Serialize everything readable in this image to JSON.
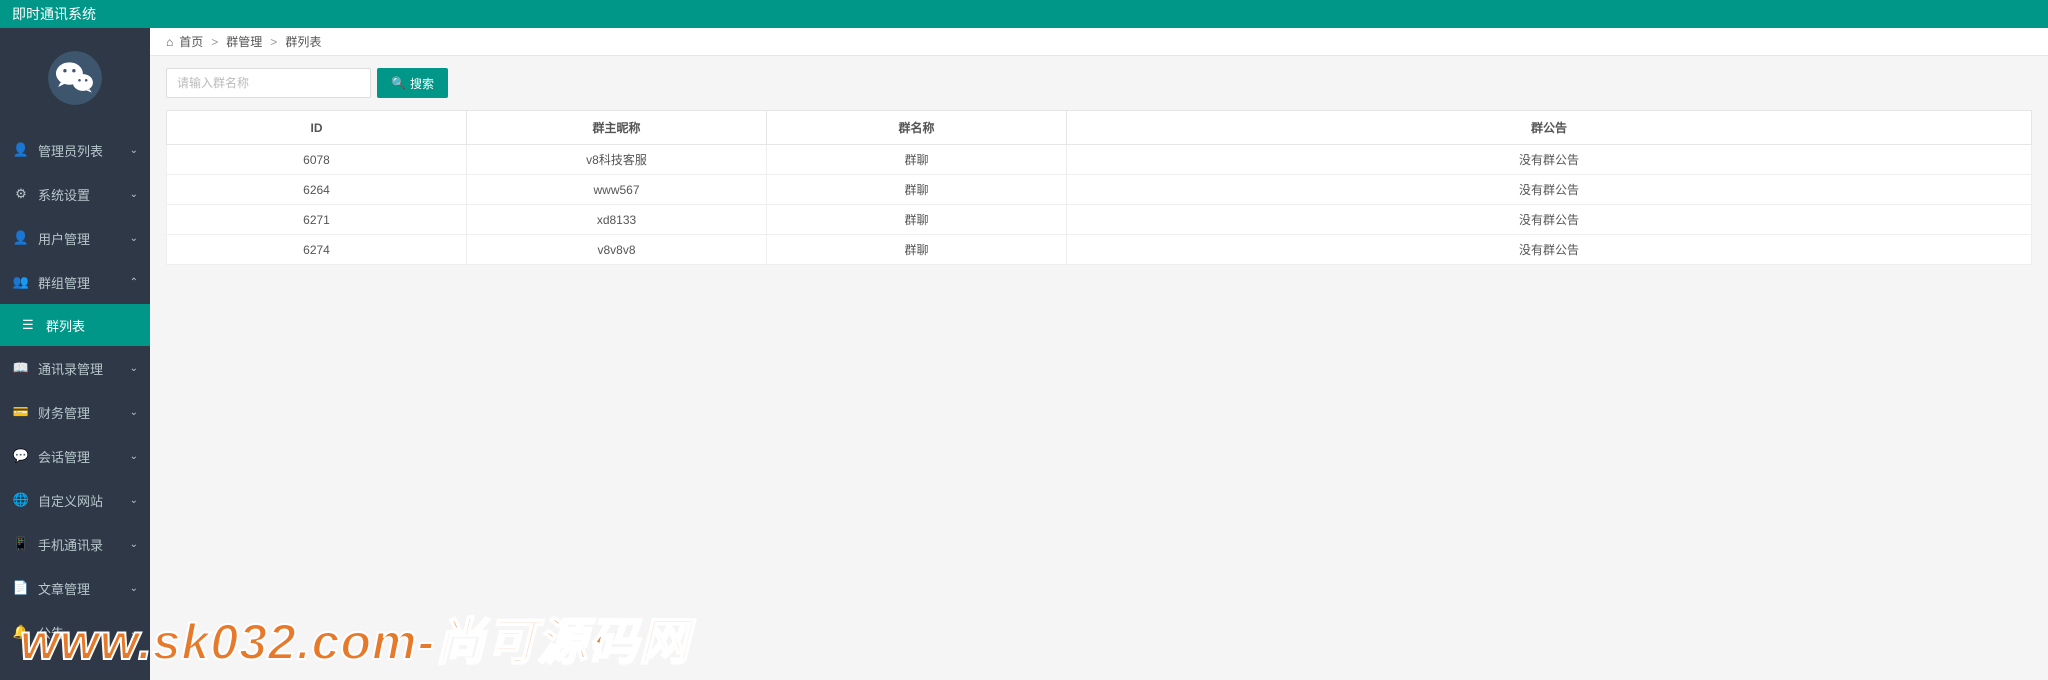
{
  "app": {
    "title": "即时通讯系统"
  },
  "sidebar": {
    "items": [
      {
        "label": "管理员列表",
        "icon": "person"
      },
      {
        "label": "系统设置",
        "icon": "gear"
      },
      {
        "label": "用户管理",
        "icon": "person"
      },
      {
        "label": "群组管理",
        "icon": "people",
        "expanded": true,
        "children": [
          {
            "label": "群列表",
            "icon": "list"
          }
        ]
      },
      {
        "label": "通讯录管理",
        "icon": "book"
      },
      {
        "label": "财务管理",
        "icon": "card"
      },
      {
        "label": "会话管理",
        "icon": "chat"
      },
      {
        "label": "自定义网站",
        "icon": "globe"
      },
      {
        "label": "手机通讯录",
        "icon": "phone"
      },
      {
        "label": "文章管理",
        "icon": "doc"
      },
      {
        "label": "公告",
        "icon": "bell"
      }
    ]
  },
  "breadcrumb": {
    "home": "首页",
    "sep": ">",
    "l2": "群管理",
    "l3": "群列表"
  },
  "search": {
    "placeholder": "请输入群名称",
    "button": "搜索"
  },
  "table": {
    "headers": {
      "id": "ID",
      "owner": "群主昵称",
      "name": "群名称",
      "notice": "群公告"
    },
    "rows": [
      {
        "id": "6078",
        "owner": "v8科技客服",
        "name": "群聊",
        "notice": "没有群公告"
      },
      {
        "id": "6264",
        "owner": "www567",
        "name": "群聊",
        "notice": "没有群公告"
      },
      {
        "id": "6271",
        "owner": "xd8133",
        "name": "群聊",
        "notice": "没有群公告"
      },
      {
        "id": "6274",
        "owner": "v8v8v8",
        "name": "群聊",
        "notice": "没有群公告"
      }
    ]
  },
  "watermark": "www.sk032.com-尚可源码网"
}
